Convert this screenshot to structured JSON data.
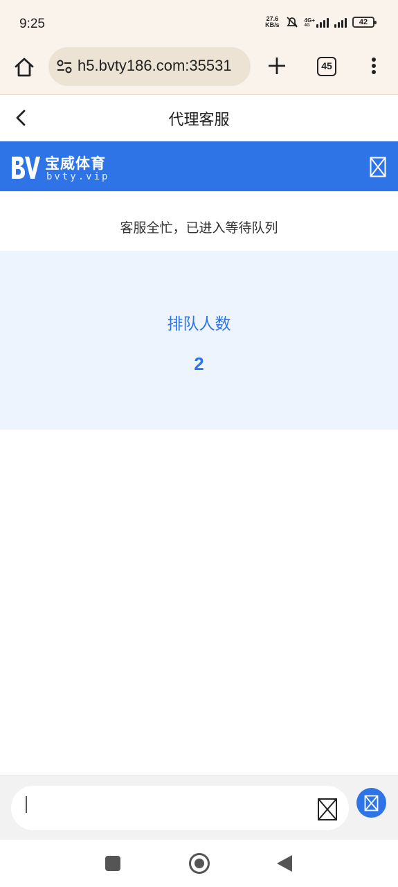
{
  "status_bar": {
    "time": "9:25",
    "net_speed_value": "27.6",
    "net_speed_unit": "KB/s",
    "network_label_1": "4G+",
    "network_label_2": "4G",
    "battery": "42"
  },
  "browser": {
    "url": "h5.bvty186.com:35531",
    "tab_count": "45"
  },
  "header": {
    "title": "代理客服"
  },
  "brand": {
    "name": "宝威体育",
    "domain": "bvty.vip",
    "color": "#2f74e6"
  },
  "notice": {
    "text": "客服全忙，已进入等待队列"
  },
  "queue": {
    "label": "排队人数",
    "count": "2"
  },
  "composer": {
    "placeholder": ""
  },
  "icons": {
    "home": "home-icon",
    "site_settings": "tune-icon",
    "new_tab": "plus-icon",
    "menu": "more-vert-icon",
    "back": "chevron-left-icon",
    "close": "close-icon",
    "emoji": "emoji-icon",
    "send": "send-icon"
  }
}
